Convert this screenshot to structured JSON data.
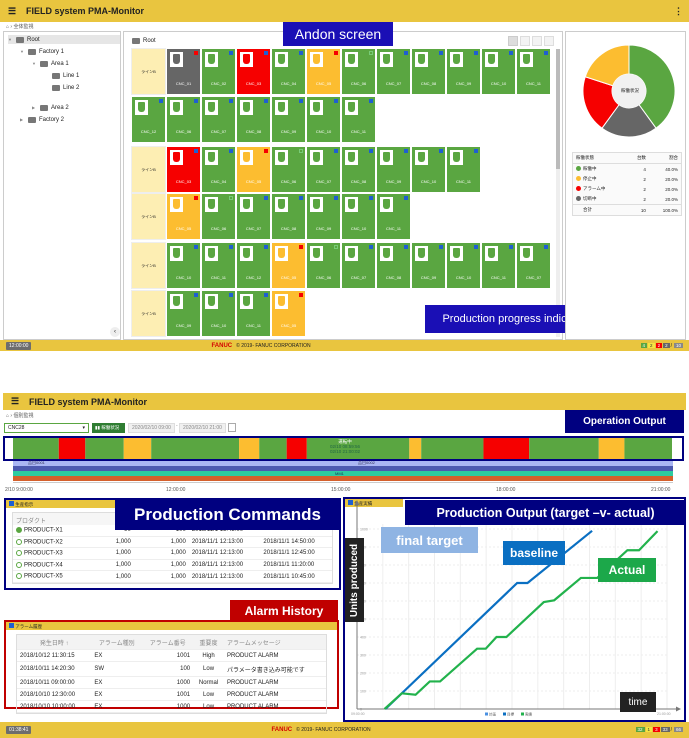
{
  "app_title": "FIELD system PMA-Monitor",
  "colors": {
    "header": "#e9c53f",
    "running": "#5aa641",
    "stopped": "#fcbd30",
    "alarm": "#f60000",
    "disconnected": "#666666",
    "indicator_blue": "#1f5fd1",
    "overlay_blue": "#1a0fb5",
    "overlay_navy": "#000080",
    "overlay_red": "#c00000"
  },
  "andon": {
    "breadcrumb": "全体監視",
    "overlay_label": "Andon screen",
    "progress_label": "Production progress indicator",
    "tree": [
      {
        "label": "Root",
        "level": 0,
        "expand": "▼",
        "selected": true
      },
      {
        "label": "Factory 1",
        "level": 1,
        "expand": "▼"
      },
      {
        "label": "Area 1",
        "level": 2,
        "expand": "▼"
      },
      {
        "label": "Line 1",
        "level": 3,
        "expand": ""
      },
      {
        "label": "Line 2",
        "level": 3,
        "expand": ""
      },
      {
        "label": "Area 2",
        "level": 2,
        "expand": "▶"
      },
      {
        "label": "Factory 2",
        "level": 1,
        "expand": "▶"
      }
    ],
    "main_title": "Root",
    "rows": [
      {
        "label": "ラインB",
        "tiles": [
          [
            "CNC_01",
            "disconnected",
            "alarm"
          ],
          [
            "CNC_02",
            "running",
            "blue"
          ],
          [
            "CNC_03",
            "alarm",
            "blue"
          ],
          [
            "CNC_04",
            "running",
            "blue"
          ],
          [
            "CNC_05",
            "stopped",
            "alarm"
          ],
          [
            "CNC_06",
            "running",
            "running"
          ],
          [
            "CNC_07",
            "running",
            "blue"
          ],
          [
            "CNC_08",
            "running",
            "blue"
          ],
          [
            "CNC_09",
            "running",
            "blue"
          ],
          [
            "CNC_10",
            "running",
            "blue"
          ],
          [
            "CNC_11",
            "running",
            "blue"
          ]
        ]
      },
      {
        "label": "",
        "tiles": [
          [
            "CNC_12",
            "running",
            "blue"
          ],
          [
            "CNC_06",
            "running",
            "blue"
          ],
          [
            "CNC_07",
            "running",
            "blue"
          ],
          [
            "CNC_08",
            "running",
            "blue"
          ],
          [
            "CNC_09",
            "running",
            "blue"
          ],
          [
            "CNC_10",
            "running",
            "blue"
          ],
          [
            "CNC_11",
            "running",
            "blue"
          ]
        ]
      },
      {
        "label": "ラインB",
        "tiles": [
          [
            "CNC_03",
            "alarm",
            "blue"
          ],
          [
            "CNC_04",
            "running",
            "blue"
          ],
          [
            "CNC_05",
            "stopped",
            "alarm"
          ],
          [
            "CNC_06",
            "running",
            "running"
          ],
          [
            "CNC_07",
            "running",
            "blue"
          ],
          [
            "CNC_08",
            "running",
            "blue"
          ],
          [
            "CNC_09",
            "running",
            "blue"
          ],
          [
            "CNC_10",
            "running",
            "blue"
          ],
          [
            "CNC_11",
            "running",
            "blue"
          ]
        ]
      },
      {
        "label": "ラインB",
        "tiles": [
          [
            "CNC_05",
            "stopped",
            "alarm"
          ],
          [
            "CNC_06",
            "running",
            "running"
          ],
          [
            "CNC_07",
            "running",
            "blue"
          ],
          [
            "CNC_08",
            "running",
            "blue"
          ],
          [
            "CNC_09",
            "running",
            "blue"
          ],
          [
            "CNC_10",
            "running",
            "blue"
          ],
          [
            "CNC_11",
            "running",
            "blue"
          ]
        ]
      },
      {
        "label": "ラインB",
        "tiles": [
          [
            "CNC_10",
            "running",
            "blue"
          ],
          [
            "CNC_11",
            "running",
            "blue"
          ],
          [
            "CNC_12",
            "running",
            "blue"
          ],
          [
            "CNC_05",
            "stopped",
            "alarm"
          ],
          [
            "CNC_06",
            "running",
            "running"
          ],
          [
            "CNC_07",
            "running",
            "blue"
          ],
          [
            "CNC_08",
            "running",
            "blue"
          ],
          [
            "CNC_09",
            "running",
            "blue"
          ],
          [
            "CNC_10",
            "running",
            "blue"
          ],
          [
            "CNC_11",
            "running",
            "blue"
          ],
          [
            "CNC_07",
            "running",
            "blue"
          ]
        ]
      },
      {
        "label": "ラインB",
        "tiles": [
          [
            "CNC_09",
            "running",
            "blue"
          ],
          [
            "CNC_10",
            "running",
            "blue"
          ],
          [
            "CNC_11",
            "running",
            "blue"
          ],
          [
            "CNC_05",
            "stopped",
            "alarm"
          ]
        ]
      }
    ],
    "pie": {
      "center_label": "稼働状況",
      "slices": [
        {
          "status": "running",
          "value": 4
        },
        {
          "status": "disconnected",
          "value": 2
        },
        {
          "status": "alarm",
          "value": 2
        },
        {
          "status": "stopped",
          "value": 2
        }
      ]
    },
    "legend": {
      "headers": [
        "稼働状態",
        "台数",
        "割合"
      ],
      "rows": [
        {
          "status": "running",
          "label": "稼働中",
          "count": "4",
          "pct": "40.0%"
        },
        {
          "status": "stopped",
          "label": "停止中",
          "count": "2",
          "pct": "20.0%"
        },
        {
          "status": "alarm",
          "label": "アラーム中",
          "count": "2",
          "pct": "20.0%"
        },
        {
          "status": "disconnected",
          "label": "切断中",
          "count": "2",
          "pct": "20.0%"
        }
      ],
      "total": {
        "label": "合計",
        "count": "10",
        "pct": "100.0%"
      }
    },
    "footer": {
      "time": "12:00:00",
      "brand": "FANUC",
      "copyright": "© 2019- FANUC CORPORATION",
      "counts": [
        {
          "v": "4",
          "c": "running"
        },
        {
          "v": "2",
          "c": "stopped"
        },
        {
          "v": "2",
          "c": "alarm"
        },
        {
          "v": "2",
          "c": "disconnected"
        }
      ],
      "total": "10"
    }
  },
  "monitor": {
    "breadcrumb": "個別監視",
    "machine_select": "CNC28",
    "status_button": "稼働状況",
    "date_from": "2020/02/10 09:00",
    "date_sep": "-",
    "date_to": "2020/02/10 21:00",
    "overlay_label": "Operation Output",
    "timeline": {
      "start": "09:00",
      "end": "21:00",
      "segments": [
        [
          "09:00",
          "09:50",
          "running"
        ],
        [
          "09:50",
          "10:19",
          "alarm"
        ],
        [
          "10:19",
          "11:01",
          "running"
        ],
        [
          "11:01",
          "11:31",
          "stopped"
        ],
        [
          "11:31",
          "13:07",
          "running"
        ],
        [
          "13:07",
          "13:29",
          "stopped"
        ],
        [
          "13:29",
          "13:59",
          "running"
        ],
        [
          "13:59",
          "14:21",
          "alarm"
        ],
        [
          "14:21",
          "16:13",
          "running"
        ],
        [
          "16:13",
          "16:26",
          "stopped"
        ],
        [
          "16:26",
          "17:34",
          "running"
        ],
        [
          "17:34",
          "18:24",
          "alarm"
        ],
        [
          "18:24",
          "19:40",
          "running"
        ],
        [
          "19:40",
          "20:08",
          "stopped"
        ],
        [
          "20:08",
          "21:00",
          "running"
        ]
      ],
      "tooltip": [
        "運転中",
        "02/10 08:59:56",
        "02/10 21:00:02"
      ],
      "product_labels": [
        "品目0001",
        "品目0002"
      ],
      "program_label": "MM1",
      "axis_labels": [
        "2/10 9:00:00",
        "12:00:00",
        "15:00:00",
        "18:00:00",
        "21:00:00"
      ]
    },
    "commands": {
      "header": "生産指示",
      "overlay_label": "Production Commands",
      "col_header": "プロダクト",
      "rows": [
        [
          "PRODUCT-X1",
          "90",
          "100",
          "2018/11/1 13:45:00",
          "",
          true
        ],
        [
          "PRODUCT-X2",
          "1,000",
          "1,000",
          "2018/11/1 12:13:00",
          "2018/11/1 14:50:00",
          false
        ],
        [
          "PRODUCT-X3",
          "1,000",
          "1,000",
          "2018/11/1 12:13:00",
          "2018/11/1 12:45:00",
          false
        ],
        [
          "PRODUCT-X4",
          "1,000",
          "1,000",
          "2018/11/1 12:13:00",
          "2018/11/1 11:20:00",
          false
        ],
        [
          "PRODUCT-X5",
          "1,000",
          "1,000",
          "2018/11/1 12:13:00",
          "2018/11/1 10:45:00",
          false
        ]
      ]
    },
    "alarms": {
      "header": "アラーム履歴",
      "overlay_label": "Alarm History",
      "columns": [
        "発生日時 ↑",
        "アラーム種別",
        "アラーム番号",
        "重要度",
        "アラームメッセージ"
      ],
      "rows": [
        [
          "2018/10/12 11:30:15",
          "EX",
          "1001",
          "High",
          "PRODUCT ALARM"
        ],
        [
          "2018/10/11 14:20:30",
          "SW",
          "100",
          "Low",
          "パラメータ書き込み可能です"
        ],
        [
          "2018/10/11 09:00:00",
          "EX",
          "1000",
          "Normal",
          "PRODUCT ALARM"
        ],
        [
          "2018/10/10 12:30:00",
          "EX",
          "1001",
          "Low",
          "PRODUCT ALARM"
        ],
        [
          "2018/10/10 10:00:00",
          "EX",
          "1000",
          "Low",
          "PRODUCT ALARM"
        ]
      ]
    },
    "footer": {
      "time": "01:38:41",
      "brand": "FANUC",
      "copyright": "© 2019- FANUC CORPORATION",
      "counts": [
        {
          "v": "32",
          "c": "running"
        },
        {
          "v": "1",
          "c": "stopped"
        },
        {
          "v": "3",
          "c": "alarm"
        },
        {
          "v": "33",
          "c": "disconnected"
        }
      ],
      "total": "66"
    }
  },
  "chart_data": {
    "type": "line",
    "header": "生産実績",
    "title": "Production Output (target –v- actual)",
    "annotations": [
      "final target",
      "baseline",
      "Actual"
    ],
    "ylabel": "Units produced",
    "xlabel": "time",
    "xlim": [
      "09:00:00",
      "21:00:00"
    ],
    "x_tick_labels": [
      "09:00:00",
      "21:00:00"
    ],
    "ylim": [
      0,
      1000
    ],
    "y_ticks": [
      0,
      100,
      200,
      300,
      400,
      500,
      600,
      700,
      800,
      900,
      1000
    ],
    "grid": true,
    "legend_placement": "bottom",
    "legend": [
      "計画",
      "目標",
      "実績"
    ],
    "series": [
      {
        "name": "計画",
        "color": "#4a90e2",
        "points": []
      },
      {
        "name": "目標",
        "color": "#0a6fc2",
        "points": [
          [
            "10:06",
            0
          ],
          [
            "15:12",
            700
          ],
          [
            "15:36",
            700
          ],
          [
            "18:06",
            990
          ]
        ]
      },
      {
        "name": "実績",
        "color": "#22b24c",
        "points": [
          [
            "10:04",
            0
          ],
          [
            "10:44",
            87
          ],
          [
            "11:16",
            79
          ],
          [
            "11:49",
            153
          ],
          [
            "12:13",
            153
          ],
          [
            "13:39",
            335
          ],
          [
            "13:59",
            335
          ],
          [
            "14:24",
            400
          ],
          [
            "14:47",
            400
          ],
          [
            "16:14",
            594
          ],
          [
            "16:38",
            604
          ],
          [
            "17:40",
            728
          ],
          [
            "18:18",
            728
          ],
          [
            "19:28",
            882
          ],
          [
            "19:55",
            882
          ],
          [
            "20:38",
            988
          ]
        ]
      }
    ]
  }
}
